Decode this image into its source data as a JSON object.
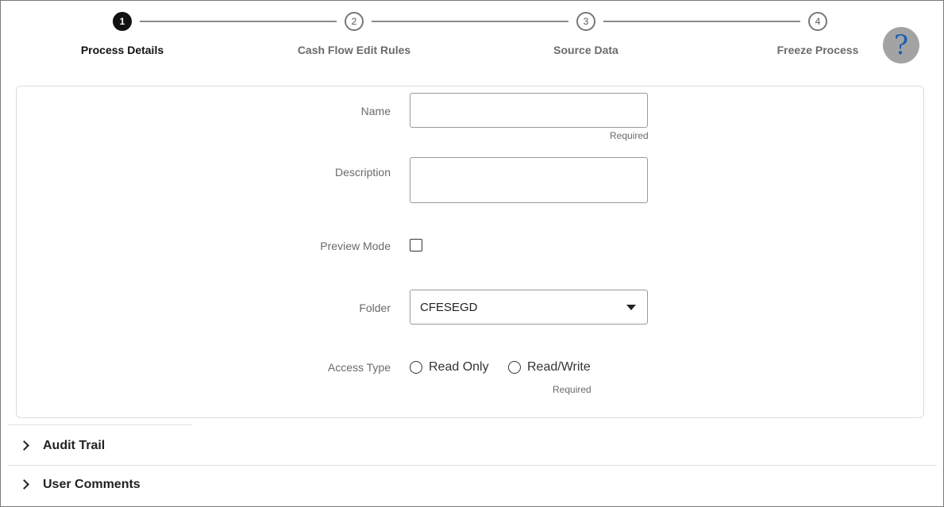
{
  "train": {
    "steps": [
      {
        "number": "1",
        "label": "Process Details",
        "state": "current"
      },
      {
        "number": "2",
        "label": "Cash Flow Edit Rules",
        "state": "pending"
      },
      {
        "number": "3",
        "label": "Source Data",
        "state": "pending"
      },
      {
        "number": "4",
        "label": "Freeze Process",
        "state": "pending"
      }
    ],
    "help_glyph": "?"
  },
  "form": {
    "name": {
      "label": "Name",
      "value": "",
      "hint": "Required"
    },
    "description": {
      "label": "Description",
      "value": ""
    },
    "preview_mode": {
      "label": "Preview Mode",
      "checked": false
    },
    "folder": {
      "label": "Folder",
      "value": "CFESEGD"
    },
    "access_type": {
      "label": "Access Type",
      "options": [
        "Read Only",
        "Read/Write"
      ],
      "selected": null,
      "hint": "Required"
    }
  },
  "sections": [
    {
      "title": "Audit Trail",
      "expanded": false
    },
    {
      "title": "User Comments",
      "expanded": false
    }
  ],
  "colors": {
    "active_step": "#111111",
    "inactive_step": "#777777",
    "help_button_bg": "#a3a3a3",
    "help_glyph": "#1a5fb4"
  },
  "icons": {
    "help": "help-icon",
    "dropdown": "caret-down-icon",
    "section_toggle": "chevron-right-icon"
  }
}
